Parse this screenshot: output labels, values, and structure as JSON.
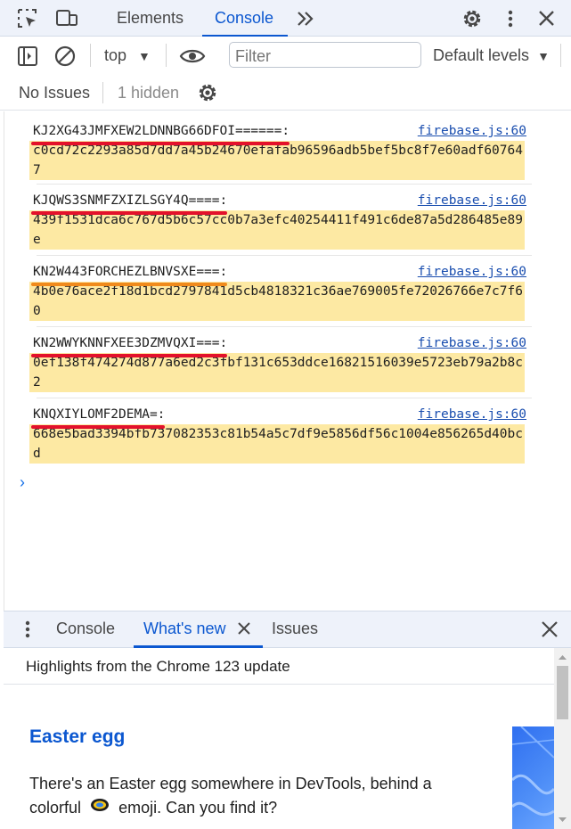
{
  "topbar": {
    "tabs": [
      {
        "label": "Elements"
      },
      {
        "label": "Console"
      }
    ],
    "icons": [
      "inspect-element-icon",
      "device-toolbar-icon",
      "more-tabs-icon",
      "settings-gear-icon",
      "kebab-menu-icon",
      "close-icon"
    ]
  },
  "toolbar": {
    "context": "top",
    "filter_placeholder": "Filter",
    "levels": "Default levels"
  },
  "issues": {
    "label": "No Issues",
    "hidden": "1 hidden"
  },
  "console": {
    "entries": [
      {
        "key": "KJ2XG43JMFXEW2LDNNBG66DFOI======:",
        "source": "firebase.js:60",
        "hash": "c0cd72c2293a85d7dd7a45b24670efafab96596adb5bef5bc8f7e60adf607647",
        "underline": "#e3112b"
      },
      {
        "key": "KJQWS3SNMFZXIZLSGY4Q====:",
        "source": "firebase.js:60",
        "hash": "439f1531dca6c767d5b6c57cc0b7a3efc40254411f491c6de87a5d286485e89e",
        "underline": "#e3112b"
      },
      {
        "key": "KN2W443FORCHEZLBNVSXE===:",
        "source": "firebase.js:60",
        "hash": "4b0e76ace2f18d1bcd2797841d5cb4818321c36ae769005fe72026766e7c7f60",
        "underline": "#f08a1c"
      },
      {
        "key": "KN2WWYKNNFXEE3DZMVQXI===:",
        "source": "firebase.js:60",
        "hash": "0ef138f474274d877a6ed2c3fbf131c653ddce16821516039e5723eb79a2b8c2",
        "underline": "#e3112b"
      },
      {
        "key": "KNQXIYLOMF2DEMA=:",
        "source": "firebase.js:60",
        "hash": "668e5bad3394bfb737082353c81b54a5c7df9e5856df56c1004e856265d40bcd",
        "underline": "#e3112b"
      }
    ],
    "prompt": "›"
  },
  "drawer": {
    "tabs": [
      {
        "label": "Console"
      },
      {
        "label": "What's new"
      },
      {
        "label": "Issues"
      }
    ],
    "highlight": "Highlights from the Chrome 123 update",
    "egg_title": "Easter egg",
    "egg_body_1": "There's an Easter egg somewhere in DevTools, behind a colorful",
    "egg_body_2": "emoji. Can you find it?"
  },
  "colors": {
    "accent": "#0b57d0",
    "hash_highlight": "#fde9a3",
    "link": "#1a4eaf"
  }
}
